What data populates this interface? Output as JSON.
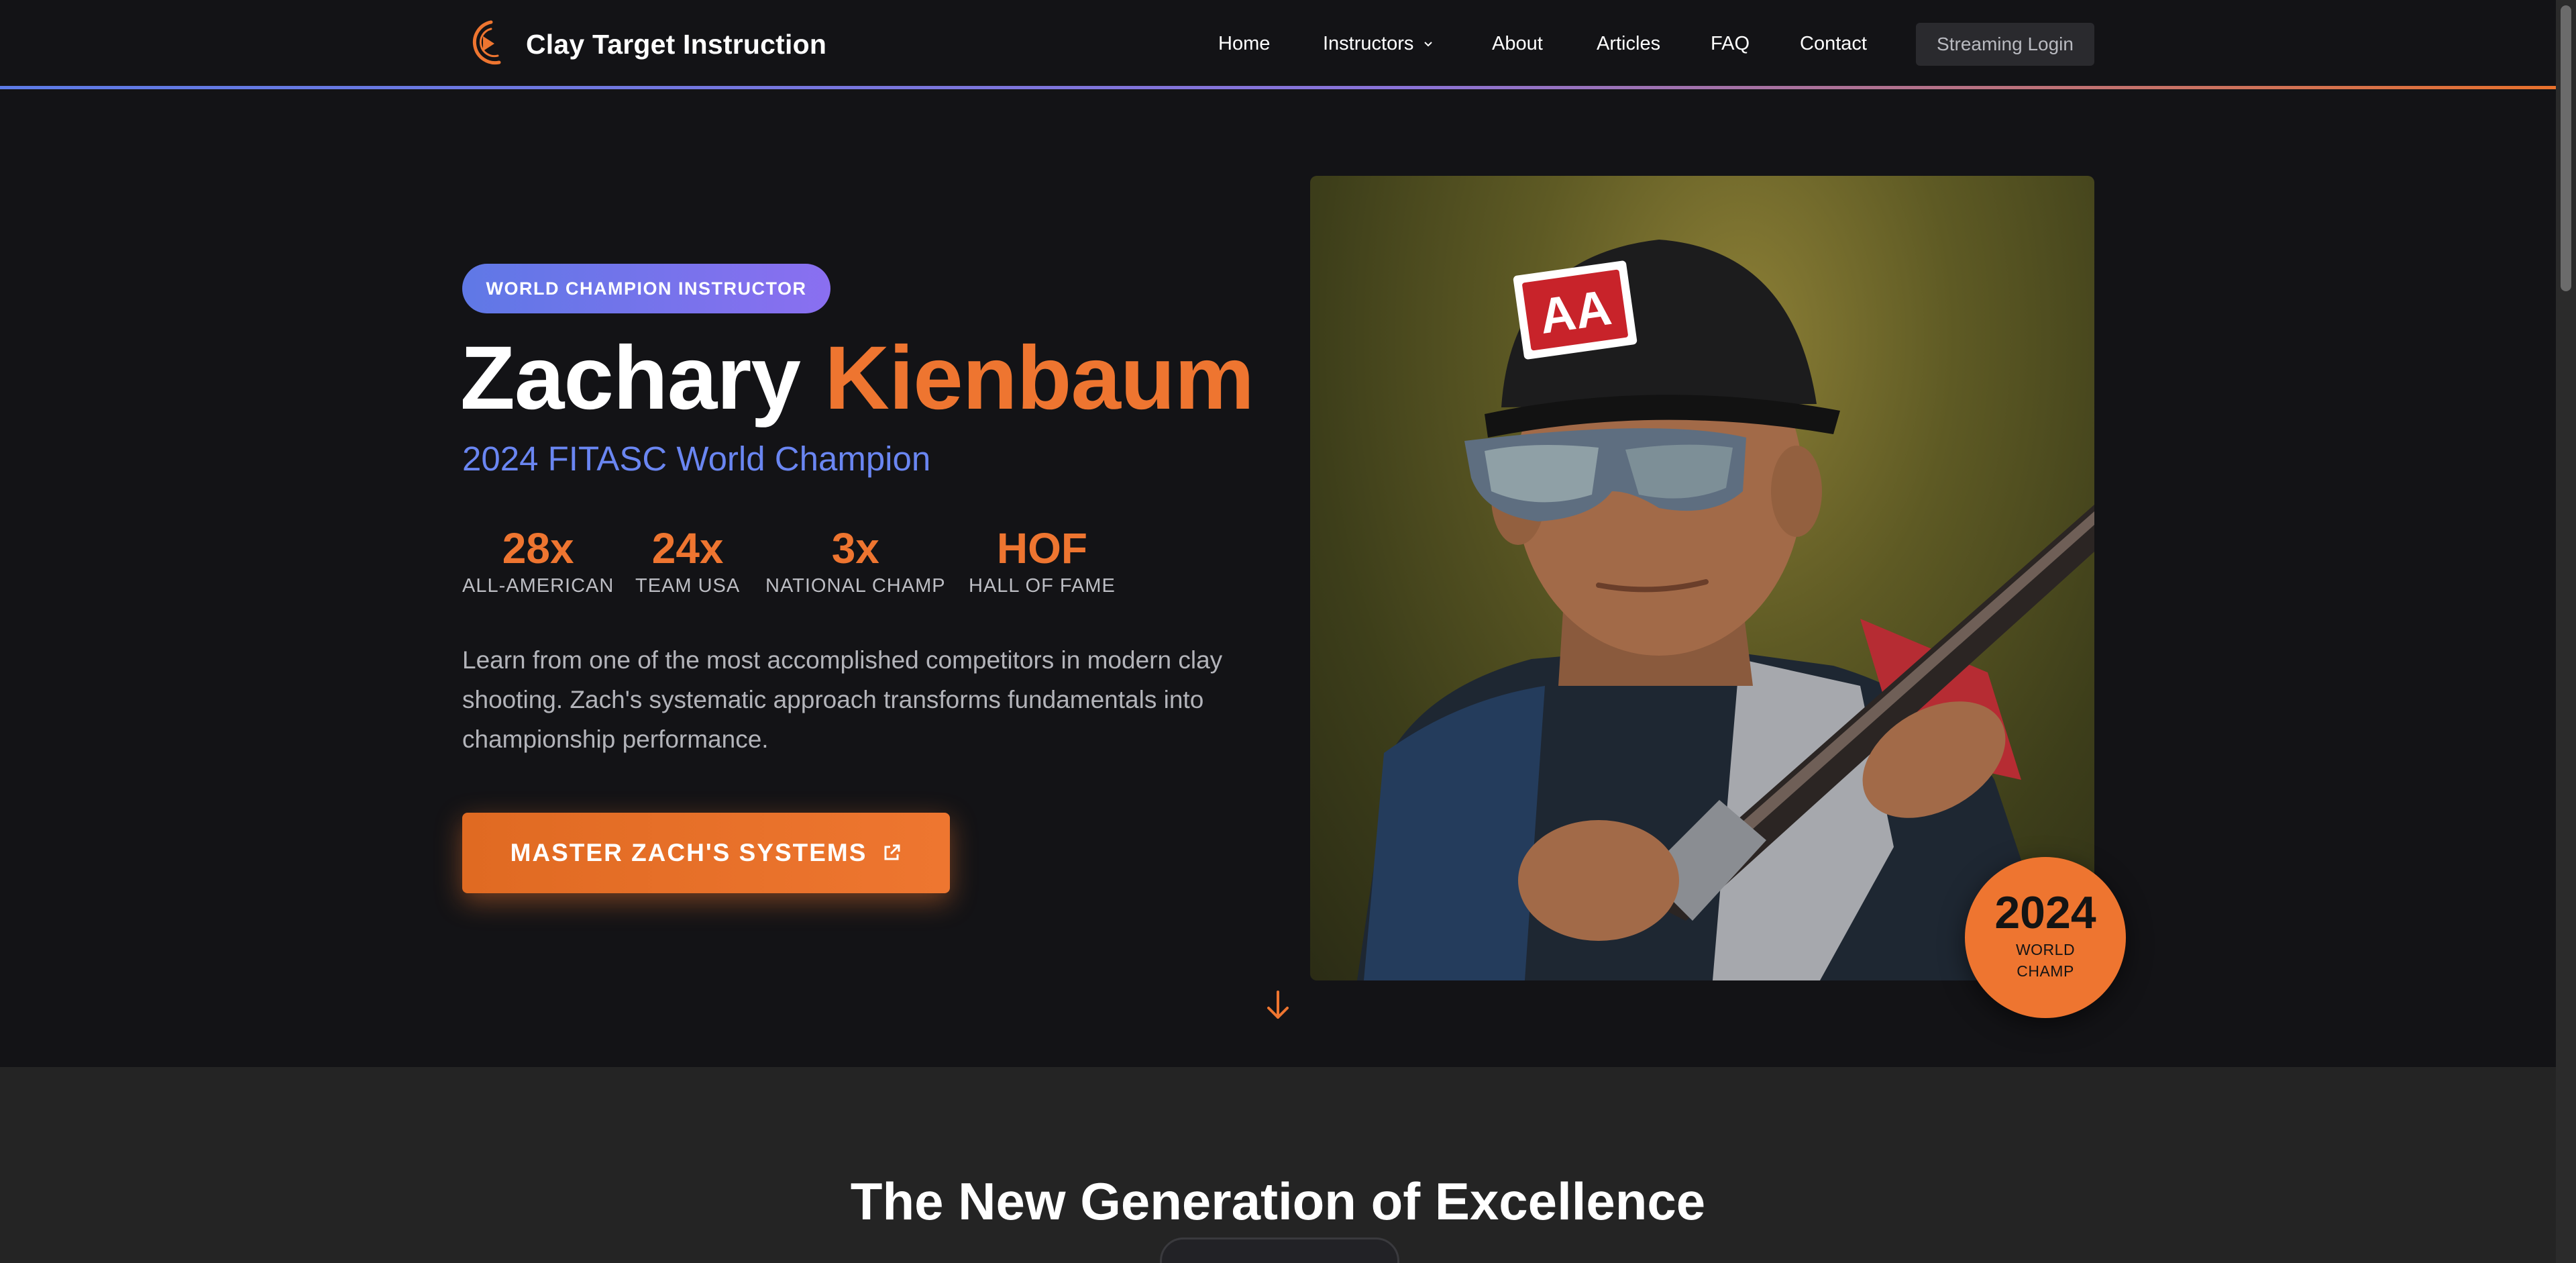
{
  "nav": {
    "brand": "Clay Target Instruction",
    "links": [
      {
        "label": "Home"
      },
      {
        "label": "Instructors"
      },
      {
        "label": "About"
      },
      {
        "label": "Articles"
      },
      {
        "label": "FAQ"
      },
      {
        "label": "Contact"
      }
    ],
    "login_label": "Streaming Login"
  },
  "hero": {
    "badge": "WORLD CHAMPION INSTRUCTOR",
    "first_name": "Zachary",
    "last_name": "Kienbaum",
    "subtitle": "2024 FITASC World Champion",
    "stats": [
      {
        "value": "28x",
        "label": "ALL-AMERICAN"
      },
      {
        "value": "24x",
        "label": "TEAM USA"
      },
      {
        "value": "3x",
        "label": "NATIONAL CHAMP"
      },
      {
        "value": "HOF",
        "label": "HALL OF FAME"
      }
    ],
    "description": "Learn from one of the most accomplished competitors in modern clay shooting. Zach's systematic approach transforms fundamentals into championship performance.",
    "cta_label": "MASTER ZACH'S SYSTEMS",
    "cta_icon": "external-link-icon",
    "photo_cap_logo": "AA",
    "champ_badge": {
      "year": "2024",
      "label": "WORLD CHAMP"
    },
    "scroll_icon": "arrow-down-icon"
  },
  "section2": {
    "title": "The New Generation of Excellence"
  },
  "colors": {
    "accent_orange": "#ee7530",
    "accent_blue": "#6a86f2",
    "badge_purple": "#8a6ff0",
    "background": "#131316",
    "section_bg": "#242424"
  }
}
